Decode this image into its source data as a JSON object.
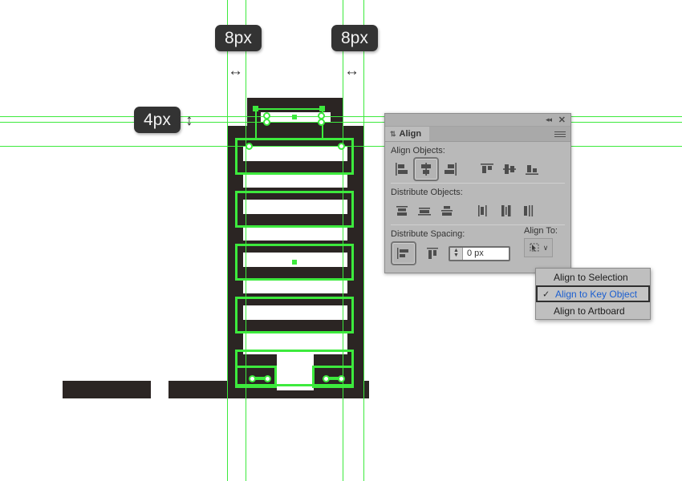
{
  "measurements": [
    {
      "id": "left-gap",
      "label": "8px",
      "axis": "horizontal"
    },
    {
      "id": "right-gap",
      "label": "8px",
      "axis": "horizontal"
    },
    {
      "id": "top-gap",
      "label": "4px",
      "axis": "vertical"
    }
  ],
  "arrow_icons": {
    "horizontal": "↔",
    "vertical": "↕"
  },
  "panel": {
    "tab_label": "Align",
    "collapse_icon": "◂◂",
    "close_icon": "✕",
    "menu_icon": "hamburger-menu-icon",
    "tab_toggle_icon": "⇅",
    "sections": {
      "align_objects_label": "Align Objects:",
      "distribute_objects_label": "Distribute Objects:",
      "distribute_spacing_label": "Distribute Spacing:",
      "align_to_label": "Align To:"
    },
    "align_objects_buttons": [
      {
        "name": "align-left",
        "selected": false
      },
      {
        "name": "align-horizontal-center",
        "selected": true
      },
      {
        "name": "align-right",
        "selected": false
      },
      {
        "name": "align-top",
        "selected": false
      },
      {
        "name": "align-vertical-center",
        "selected": false
      },
      {
        "name": "align-bottom",
        "selected": false
      }
    ],
    "distribute_objects_buttons": [
      {
        "name": "distribute-top",
        "selected": false
      },
      {
        "name": "distribute-vertical-center",
        "selected": false
      },
      {
        "name": "distribute-bottom",
        "selected": false
      },
      {
        "name": "distribute-left",
        "selected": false
      },
      {
        "name": "distribute-horizontal-center",
        "selected": false
      },
      {
        "name": "distribute-right",
        "selected": false
      }
    ],
    "distribute_spacing_buttons": [
      {
        "name": "vertical-distribute-spacing",
        "selected": true
      },
      {
        "name": "horizontal-distribute-spacing",
        "selected": false
      }
    ],
    "spacing_value": "0 px",
    "spacing_placeholder": "0 px",
    "align_to_button": "key-object-icon",
    "align_to_chevron": "∨"
  },
  "dropdown": {
    "items": [
      {
        "label": "Align to Selection",
        "checked": false
      },
      {
        "label": "Align to Key Object",
        "checked": true
      },
      {
        "label": "Align to Artboard",
        "checked": false
      }
    ],
    "check_glyph": "✓"
  },
  "colors": {
    "guide_green": "#3dea3d",
    "artwork_dark": "#2b2523",
    "panel_bg": "#b9b9b9",
    "badge_bg": "#333333",
    "selected_text": "#1c5fd0"
  }
}
